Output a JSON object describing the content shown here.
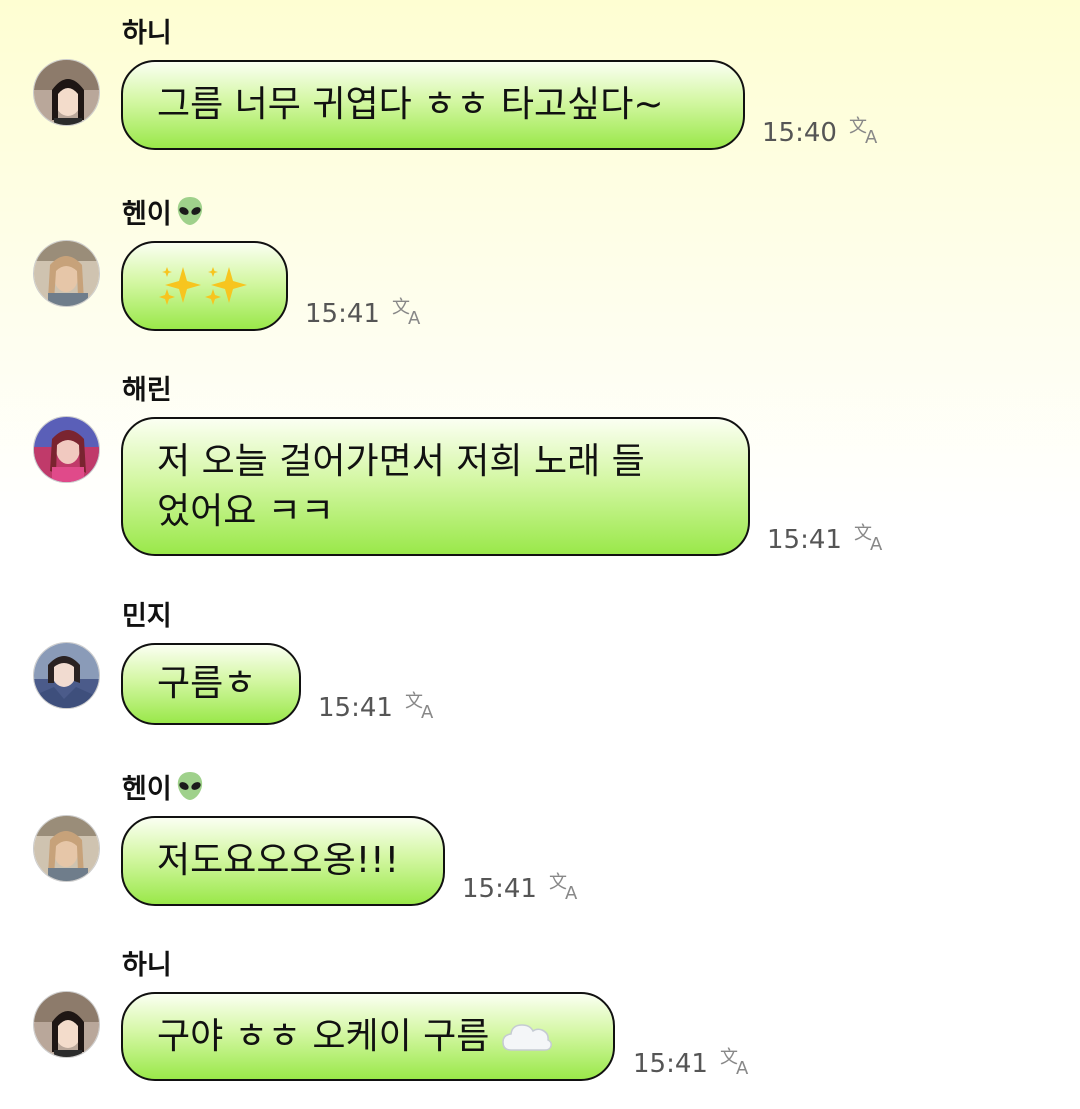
{
  "messages": [
    {
      "sender": "하니",
      "text": "그름 너무 귀엽다 ㅎㅎ 타고싶다~",
      "time": "15:40"
    },
    {
      "sender": "헨이",
      "sender_emoji": "alien-emoji",
      "text": "",
      "emoji_content": [
        "sparkles-emoji",
        "sparkles-emoji"
      ],
      "time": "15:41"
    },
    {
      "sender": "해린",
      "text_line1": "저 오늘 걸어가면서 저희 노래 들",
      "text_line2": "었어요 ㅋㅋ",
      "time": "15:41"
    },
    {
      "sender": "민지",
      "text": "구름ㅎ",
      "time": "15:41"
    },
    {
      "sender": "헨이",
      "sender_emoji": "alien-emoji",
      "text": "저도요오오옹!!!",
      "time": "15:41"
    },
    {
      "sender": "하니",
      "text": "구야 ㅎㅎ 오케이 구름",
      "trailing_emoji": "cloud-emoji",
      "time": "15:41"
    }
  ],
  "colors": {
    "bubble_top": "#fbfff2",
    "bubble_bottom": "#9ae84a",
    "background_top": "#fefed2",
    "time_text": "#555555"
  },
  "icons": {
    "translate": "translate-icon",
    "avatar": "avatar"
  }
}
